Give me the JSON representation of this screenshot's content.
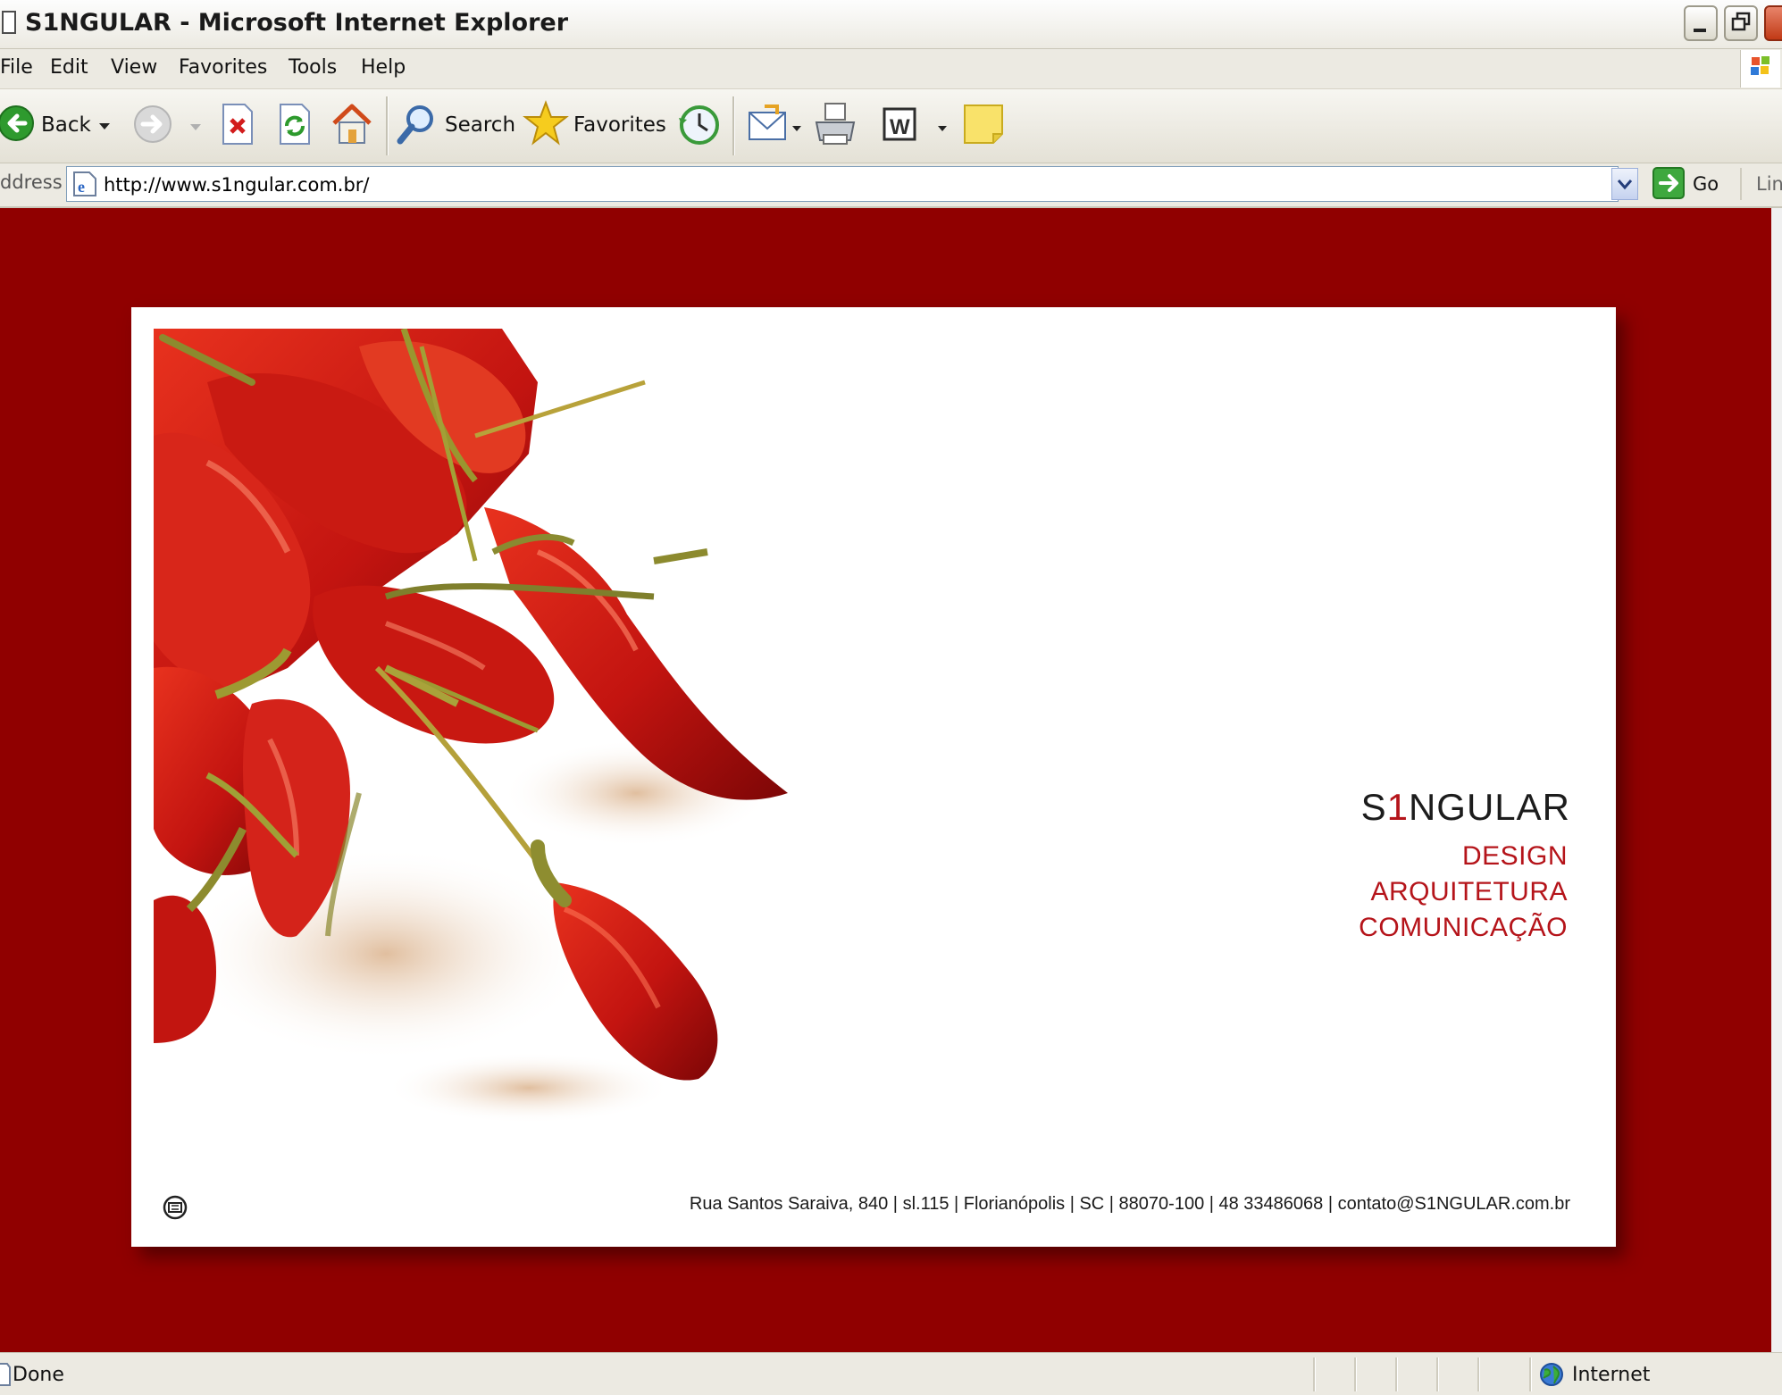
{
  "window": {
    "title": "S1NGULAR - Microsoft Internet Explorer"
  },
  "menu": {
    "items": [
      "File",
      "Edit",
      "View",
      "Favorites",
      "Tools",
      "Help"
    ]
  },
  "toolbar": {
    "back_label": "Back",
    "search_label": "Search",
    "favorites_label": "Favorites"
  },
  "address_bar": {
    "label": "ddress",
    "value": "http://www.s1ngular.com.br/",
    "go_label": "Go",
    "links_label": "Lin"
  },
  "page": {
    "background_color": "#900000",
    "brand": {
      "prefix": "S",
      "highlight": "1",
      "suffix": "NGULAR",
      "highlight_color": "#b5141a",
      "services": [
        "DESIGN",
        "ARQUITETURA",
        "COMUNICAÇÃO"
      ],
      "services_color": "#b5141a"
    },
    "footer": {
      "address": "Rua Santos Saraiva, 840 | sl.115 | Florianópolis | SC | 88070-100 | 48 33486068 | contato@S1NGULAR.com.br",
      "icon": "badge-icon"
    }
  },
  "status_bar": {
    "text": "Done",
    "zone": "Internet"
  }
}
